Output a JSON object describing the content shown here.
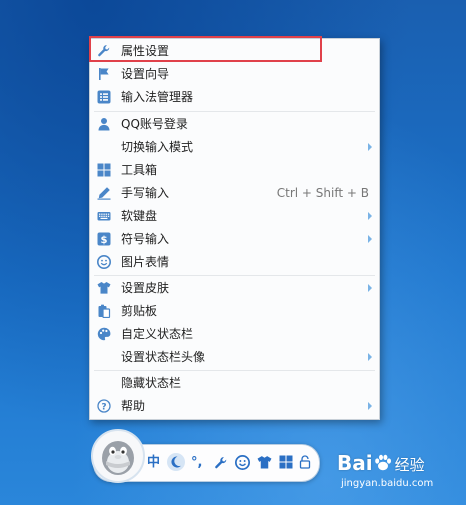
{
  "menu": {
    "items": [
      {
        "label": "属性设置",
        "icon": "wrench-icon"
      },
      {
        "label": "设置向导",
        "icon": "flag-icon"
      },
      {
        "label": "输入法管理器",
        "icon": "list-icon"
      },
      {
        "label": "QQ账号登录",
        "icon": "user-icon"
      },
      {
        "label": "切换输入模式",
        "icon": ""
      },
      {
        "label": "工具箱",
        "icon": "grid-icon"
      },
      {
        "label": "手写输入",
        "icon": "pen-icon",
        "shortcut": "Ctrl + Shift + B"
      },
      {
        "label": "软键盘",
        "icon": "keyboard-icon"
      },
      {
        "label": "符号输入",
        "icon": "dollar-icon"
      },
      {
        "label": "图片表情",
        "icon": "smiley-icon"
      },
      {
        "label": "设置皮肤",
        "icon": "shirt-icon"
      },
      {
        "label": "剪贴板",
        "icon": "clipboard-icon"
      },
      {
        "label": "自定义状态栏",
        "icon": "palette-icon"
      },
      {
        "label": "设置状态栏头像",
        "icon": ""
      },
      {
        "label": "隐藏状态栏",
        "icon": ""
      },
      {
        "label": "帮助",
        "icon": "help-icon"
      }
    ]
  },
  "statusbar": {
    "mode_label": "中",
    "punct_label": "°,"
  },
  "watermark": {
    "brand_left": "Bai",
    "brand_right": "经验",
    "url": "jingyan.baidu.com"
  },
  "colors": {
    "desktop": "#1c74cc",
    "menu_bg": "#fbfcfd",
    "icon_blue": "#4a86c8",
    "highlight_red": "#e0414a",
    "submenu_arrow": "#7ab3e6"
  }
}
